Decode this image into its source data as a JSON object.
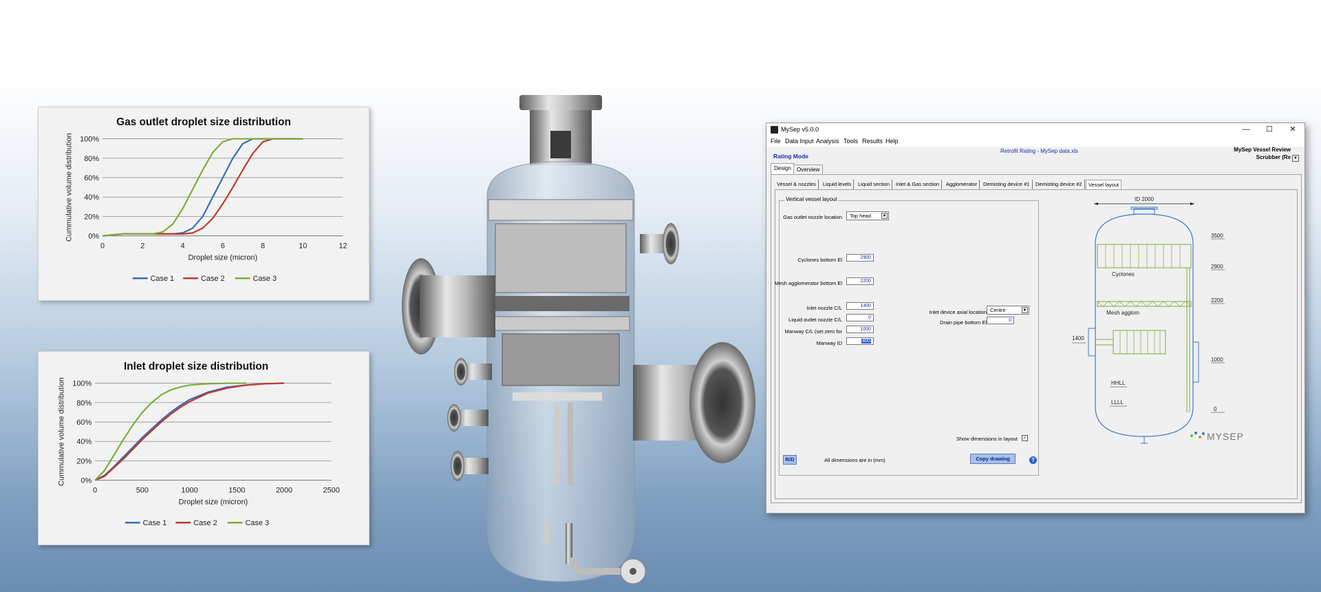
{
  "chart_data": [
    {
      "type": "line",
      "title": "Gas outlet droplet size distribution",
      "xlabel": "Droplet size (micron)",
      "ylabel": "Cummulative volume distribution",
      "xlim": [
        0,
        12
      ],
      "ylim": [
        0,
        100
      ],
      "xticks": [
        "0",
        "2",
        "4",
        "6",
        "8",
        "10",
        "12"
      ],
      "yticks": [
        "0%",
        "20%",
        "40%",
        "60%",
        "80%",
        "100%"
      ],
      "grid": true,
      "legend": "bottom",
      "series": [
        {
          "name": "Case 1",
          "color": "#3a6ab4",
          "x": [
            0,
            1,
            2,
            3,
            3.5,
            4,
            4.5,
            5,
            5.5,
            6,
            6.5,
            7,
            7.5,
            8,
            10
          ],
          "y": [
            0,
            2,
            2,
            2,
            2,
            3,
            8,
            20,
            40,
            60,
            80,
            95,
            100,
            100,
            100
          ]
        },
        {
          "name": "Case 2",
          "color": "#c0392b",
          "x": [
            0,
            1,
            2,
            3,
            4,
            4.5,
            5,
            5.5,
            6,
            6.5,
            7,
            7.5,
            8,
            8.5,
            10
          ],
          "y": [
            0,
            2,
            2,
            2,
            2,
            3,
            8,
            18,
            33,
            50,
            68,
            85,
            97,
            100,
            100
          ]
        },
        {
          "name": "Case 3",
          "color": "#7cac3a",
          "x": [
            0,
            1,
            2,
            2.5,
            3,
            3.5,
            4,
            4.5,
            5,
            5.5,
            6,
            6.5,
            7,
            10
          ],
          "y": [
            0,
            2,
            2,
            2,
            4,
            12,
            28,
            48,
            68,
            86,
            97,
            100,
            100,
            100
          ]
        }
      ]
    },
    {
      "type": "line",
      "title": "Inlet droplet size distribution",
      "xlabel": "Droplet size (micron)",
      "ylabel": "Cummulative volume distribution",
      "xlim": [
        0,
        2500
      ],
      "ylim": [
        0,
        100
      ],
      "xticks": [
        "0",
        "500",
        "1000",
        "1500",
        "2000",
        "2500"
      ],
      "yticks": [
        "0%",
        "20%",
        "40%",
        "60%",
        "80%",
        "100%"
      ],
      "grid": true,
      "legend": "bottom",
      "series": [
        {
          "name": "Case 1",
          "color": "#3a6ab4",
          "x": [
            0,
            100,
            200,
            300,
            400,
            500,
            600,
            700,
            800,
            900,
            1000,
            1200,
            1400,
            1600,
            1800,
            2000
          ],
          "y": [
            0,
            5,
            14,
            24,
            34,
            44,
            53,
            62,
            70,
            77,
            83,
            91,
            96,
            98,
            99.5,
            100
          ]
        },
        {
          "name": "Case 2",
          "color": "#c0392b",
          "x": [
            0,
            100,
            200,
            300,
            400,
            500,
            600,
            700,
            800,
            900,
            1000,
            1200,
            1400,
            1600,
            1800,
            2000
          ],
          "y": [
            0,
            4,
            13,
            22,
            32,
            42,
            51,
            60,
            68,
            75,
            81,
            90,
            95,
            98,
            99.5,
            100
          ]
        },
        {
          "name": "Case 3",
          "color": "#7cac3a",
          "x": [
            0,
            100,
            200,
            300,
            400,
            500,
            600,
            700,
            800,
            900,
            1000,
            1200,
            1400,
            1600
          ],
          "y": [
            0,
            10,
            26,
            42,
            57,
            70,
            80,
            88,
            93,
            96,
            98,
            99.5,
            100,
            100
          ]
        }
      ]
    }
  ],
  "app": {
    "title": "MySep  v5.0.0",
    "window_buttons": [
      "—",
      "☐",
      "✕"
    ],
    "menu": [
      "File",
      "Data Input",
      "Analysis",
      "Tools",
      "Results",
      "Help"
    ],
    "mode": "Rating Mode",
    "file_label": "Retrofit Rating - MySep data.xls",
    "review_label": "MySep Vessel Review",
    "scrubber": "Scrubber (Re",
    "top_tabs": [
      "Design",
      "Overview"
    ],
    "sub_tabs": [
      "Vessel & nozzles",
      "Liquid levels",
      "Liquid section",
      "Inlet & Gas section",
      "Agglomerator",
      "Demisting device #1",
      "Demisting device #2",
      "Vessel layout"
    ],
    "group_title": "Vertical vessel layout",
    "gas_outlet_label": "Gas outlet nozzle location",
    "gas_outlet_value": "Top head",
    "fields": [
      {
        "label": "Cyclones bottom El",
        "value": "2900"
      },
      {
        "label": "Mesh agglomerator bottom El",
        "value": "2200"
      },
      {
        "label": "Inlet nozzle C/L",
        "value": "1400"
      },
      {
        "label": "Liquid outlet nozzle C/L",
        "value": "0"
      },
      {
        "label": "Manway C/L (set zero for",
        "value": "1000"
      },
      {
        "label": "Manway ID",
        "value": "800"
      }
    ],
    "inlet_device_label": "Inlet device axial location",
    "inlet_device_value": "Centre",
    "drain_label": "Drain pipe bottom El",
    "drain_value": "0",
    "show_dims_label": "Show dimensions in layout",
    "show_dims_checked": "✓",
    "rd_button": "R/D",
    "dims_note": "All dimensions are in (mm)",
    "copy_button": "Copy drawing",
    "help": "?",
    "drawing": {
      "id_label": "ID 2000",
      "elev_3500": "3500",
      "elev_2900": "2900",
      "elev_2200": "2200",
      "elev_1000": "1000",
      "elev_0": "0",
      "inlet_1400": "1400",
      "cyclones": "Cyclones",
      "mesh": "Mesh agglom",
      "hhll": "HHLL",
      "llll": "LLLL",
      "logo": "MYSEP"
    }
  }
}
